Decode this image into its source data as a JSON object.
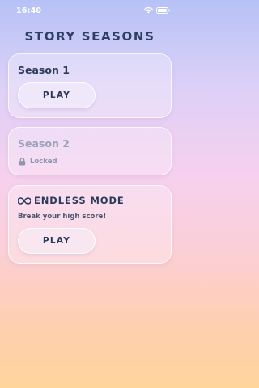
{
  "status_bar": {
    "time": "16:40",
    "icons": [
      "wifi-icon",
      "battery-icon"
    ]
  },
  "screen": {
    "title": "STORY SEASONS"
  },
  "seasons": [
    {
      "title": "Season 1",
      "button_label": "PLAY",
      "locked": false
    },
    {
      "title": "Season 2",
      "status": "Locked",
      "status_icon": "lock-icon",
      "locked": true
    }
  ],
  "endless": {
    "icon": "infinity-icon",
    "title": "ENDLESS MODE",
    "subtitle": "Break your high score!",
    "button_label": "PLAY"
  },
  "colors": {
    "text_primary": "#2c3a5a",
    "text_locked": "#9aa1b9",
    "background_top": "#b6c2f6",
    "background_bottom": "#ffd59c"
  }
}
